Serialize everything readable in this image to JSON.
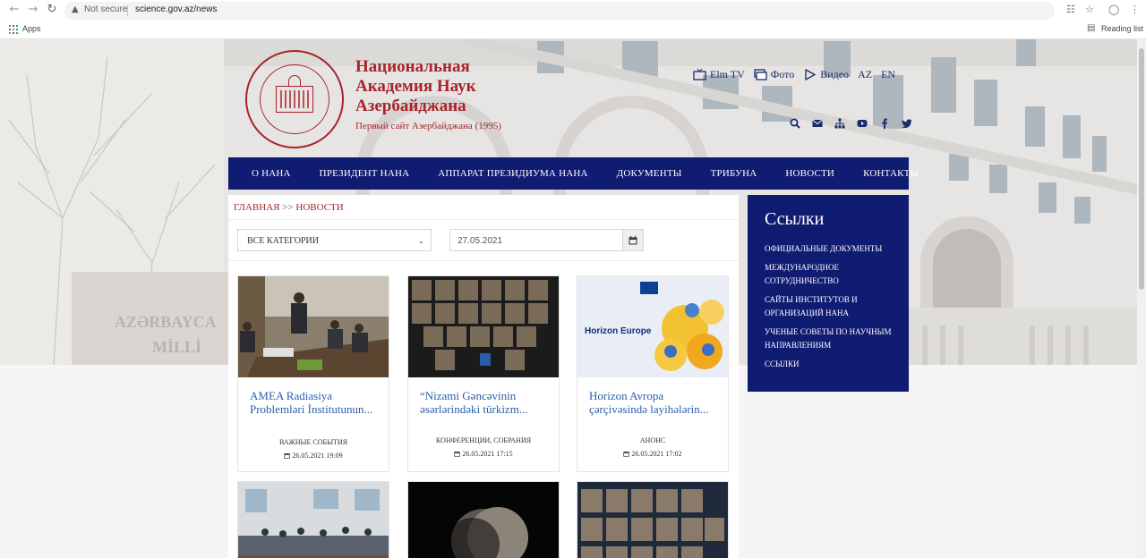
{
  "browser": {
    "security": "Not secure",
    "url": "science.gov.az/news",
    "bookmarks": [
      {
        "label": "Apps"
      },
      {
        "label": "Reading list"
      }
    ]
  },
  "header": {
    "title_lines": [
      "Национальная",
      "Академия Наук",
      "Азербайджана"
    ],
    "subtitle": "Первый сайт Азербайджана (1995)",
    "top_links": [
      {
        "label": "Elm TV",
        "icon": "tv-icon"
      },
      {
        "label": "Фото",
        "icon": "photo-icon"
      },
      {
        "label": "Видео",
        "icon": "play-icon"
      },
      {
        "label": "AZ"
      },
      {
        "label": "EN"
      }
    ],
    "social_icons": [
      "search-icon",
      "mail-icon",
      "sitemap-icon",
      "youtube-icon",
      "facebook-icon",
      "twitter-icon"
    ]
  },
  "menu": [
    "О НАНА",
    "ПРЕЗИДЕНТ НАНА",
    "АППАРАТ ПРЕЗИДИУМА НАНА",
    "ДОКУМЕНТЫ",
    "ТРИБУНА",
    "НОВОСТИ",
    "КОНТАКТЫ"
  ],
  "breadcrumb": {
    "home": "ГЛАВНАЯ",
    "separator": ">>",
    "current": "НОВОСТИ"
  },
  "filters": {
    "category_selected": "ВСЕ КАТЕГОРИИ",
    "date_value": "27.05.2021"
  },
  "news": [
    {
      "title": "AMEA Radiasiya Problemləri İnstitutunun...",
      "category": "ВАЖНЫЕ СОБЫТИЯ",
      "date": "26.05.2021 19:09"
    },
    {
      "title": "“Nizami Gəncəvinin əsərlərindəki türkizm...",
      "category": "КОНФЕРЕНЦИИ, СОБРАНИЯ",
      "date": "26.05.2021 17:15"
    },
    {
      "title": "Horizon Avropa çərçivəsində layihələrin...",
      "category": "АНОНС",
      "date": "26.05.2021 17:02"
    }
  ],
  "thumb_text": {
    "horizon": "Horizon Europe"
  },
  "sidebar": {
    "title": "Ссылки",
    "items": [
      "ОФИЦИАЛЬНЫЕ ДОКУМЕНТЫ",
      "МЕЖДУНАРОДНОЕ СОТРУДНИЧЕСТВО",
      "САЙТЫ ИНСТИТУТОВ И ОРГАНИЗАЦИЙ НАНА",
      "УЧЕНЫЕ СОВЕТЫ ПО НАУЧНЫМ НАПРАВЛЕНИЯМ",
      "ССЫЛКИ"
    ]
  },
  "colors": {
    "brand_red": "#a8232b",
    "menu_navy": "#101b72",
    "link_blue": "#2b5fa6"
  }
}
